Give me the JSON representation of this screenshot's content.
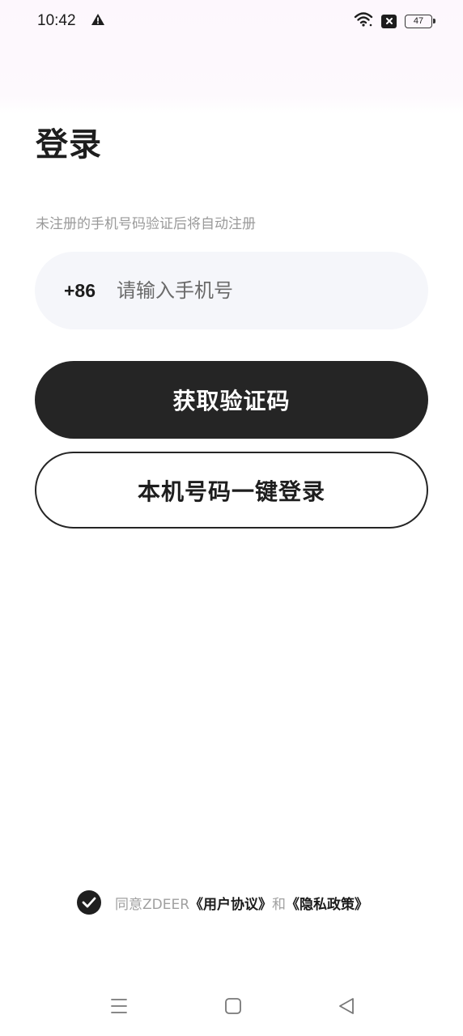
{
  "status_bar": {
    "time": "10:42",
    "battery_level": "47",
    "icons": [
      "warning-icon",
      "wifi-icon",
      "notification-x-icon",
      "battery-icon"
    ]
  },
  "login": {
    "title": "登录",
    "hint": "未注册的手机号码验证后将自动注册",
    "country_code": "+86",
    "phone_placeholder": "请输入手机号",
    "phone_value": "",
    "get_code_button": "获取验证码",
    "one_click_login_button": "本机号码一键登录"
  },
  "agreement": {
    "checked": true,
    "prefix": "同意ZDEER",
    "user_agreement": "《用户协议》",
    "and": "和",
    "privacy_policy": "《隐私政策》"
  },
  "nav_bar": {
    "icons": [
      "menu-icon",
      "home-icon",
      "back-icon"
    ]
  },
  "colors": {
    "primary": "#252525",
    "input_bg": "#f5f6fa",
    "hint_text": "#9a9a9a",
    "top_tint": "#fdf7fd"
  }
}
